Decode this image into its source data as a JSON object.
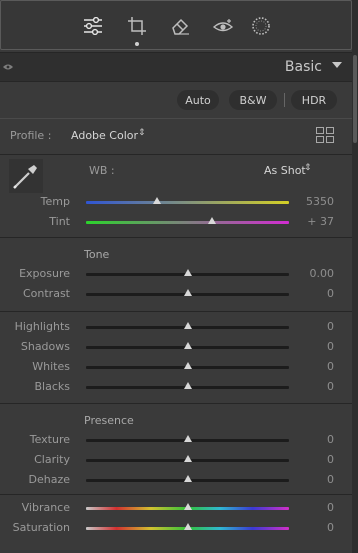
{
  "toolbar": {
    "tools": [
      {
        "name": "edit-sliders-icon"
      },
      {
        "name": "crop-icon"
      },
      {
        "name": "healing-eraser-icon"
      },
      {
        "name": "red-eye-icon"
      },
      {
        "name": "masking-circle-icon"
      }
    ],
    "active_tool": "edit-sliders-icon"
  },
  "panel": {
    "title": "Basic"
  },
  "buttons": {
    "auto": "Auto",
    "bw": "B&W",
    "hdr": "HDR"
  },
  "profile": {
    "label": "Profile :",
    "value": "Adobe Color",
    "updown": "⇕"
  },
  "wb": {
    "label": "WB :",
    "value": "As Shot",
    "updown": "⇕"
  },
  "sections": {
    "tone": "Tone",
    "presence": "Presence"
  },
  "sliders": [
    {
      "label": "Temp",
      "value": "5350",
      "position": 0.35,
      "track": "temp",
      "colors": [
        "#2f55d4",
        "#d4d026"
      ]
    },
    {
      "label": "Tint",
      "value": "+ 37",
      "position": 0.62,
      "track": "tint",
      "colors": [
        "#2cd42c",
        "#d22cd2"
      ]
    },
    {
      "label": "Exposure",
      "value": "0.00",
      "position": 0.5,
      "track": "plain"
    },
    {
      "label": "Contrast",
      "value": "0",
      "position": 0.5,
      "track": "plain"
    },
    {
      "label": "Highlights",
      "value": "0",
      "position": 0.5,
      "track": "plain"
    },
    {
      "label": "Shadows",
      "value": "0",
      "position": 0.5,
      "track": "plain"
    },
    {
      "label": "Whites",
      "value": "0",
      "position": 0.5,
      "track": "plain"
    },
    {
      "label": "Blacks",
      "value": "0",
      "position": 0.5,
      "track": "plain"
    },
    {
      "label": "Texture",
      "value": "0",
      "position": 0.5,
      "track": "plain"
    },
    {
      "label": "Clarity",
      "value": "0",
      "position": 0.5,
      "track": "plain"
    },
    {
      "label": "Dehaze",
      "value": "0",
      "position": 0.5,
      "track": "plain"
    },
    {
      "label": "Vibrance",
      "value": "0",
      "position": 0.5,
      "track": "spectrum"
    },
    {
      "label": "Saturation",
      "value": "0",
      "position": 0.5,
      "track": "spectrum"
    }
  ],
  "colors": {
    "background": "#3a3a3a",
    "header": "#2f2f2f",
    "thumb": "#d8d8d8",
    "track": "#1c1c1c"
  }
}
